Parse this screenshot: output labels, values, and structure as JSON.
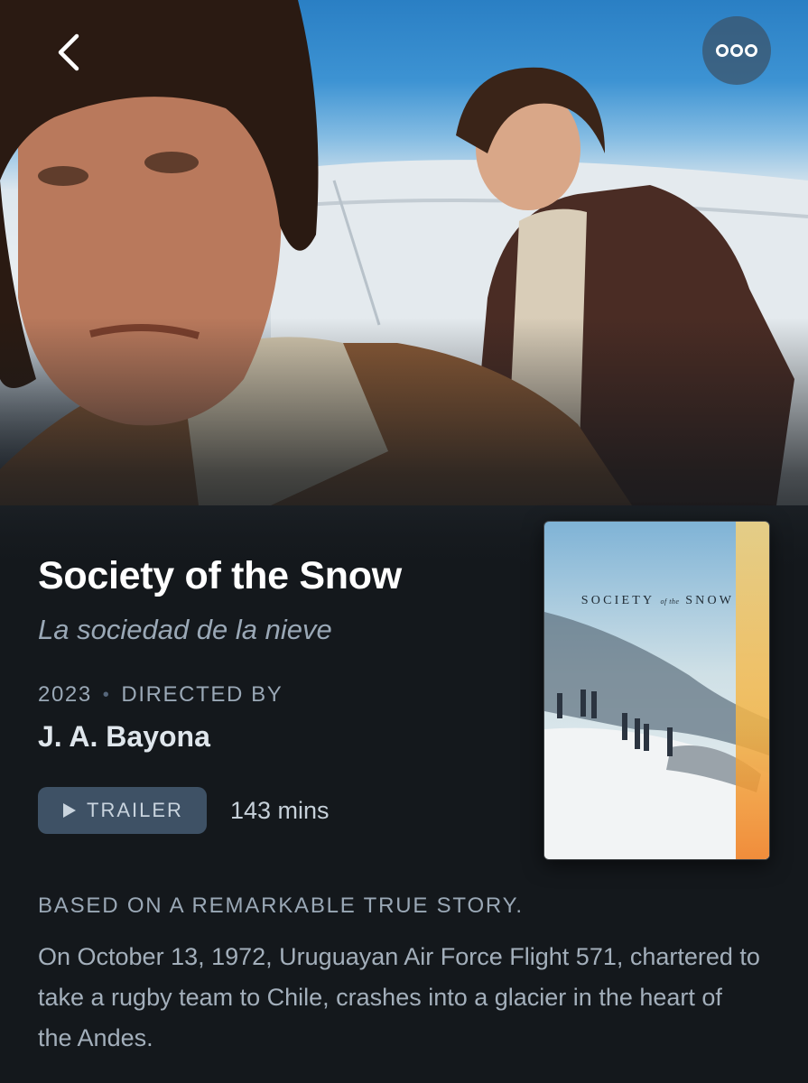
{
  "nav": {
    "back_icon": "chevron-left-icon",
    "more_icon": "ellipsis-icon"
  },
  "film": {
    "title": "Society of the Snow",
    "original_title": "La sociedad de la nieve",
    "year": "2023",
    "directed_by_label": "DIRECTED BY",
    "director": "J. A. Bayona",
    "runtime": "143 mins",
    "tagline": "BASED ON A REMARKABLE TRUE STORY.",
    "synopsis": "On October 13, 1972, Uruguayan Air Force Flight 571, chartered to take a rugby team to Chile, crashes into a glacier in the heart of the Andes."
  },
  "trailer": {
    "label": "TRAILER",
    "icon": "play-icon"
  },
  "poster": {
    "title_part1": "SOCIETY",
    "title_part2": "of the",
    "title_part3": "SNOW"
  },
  "colors": {
    "background": "#14181c",
    "button_bg": "#3e5165",
    "muted_text": "#9aa8b6"
  }
}
